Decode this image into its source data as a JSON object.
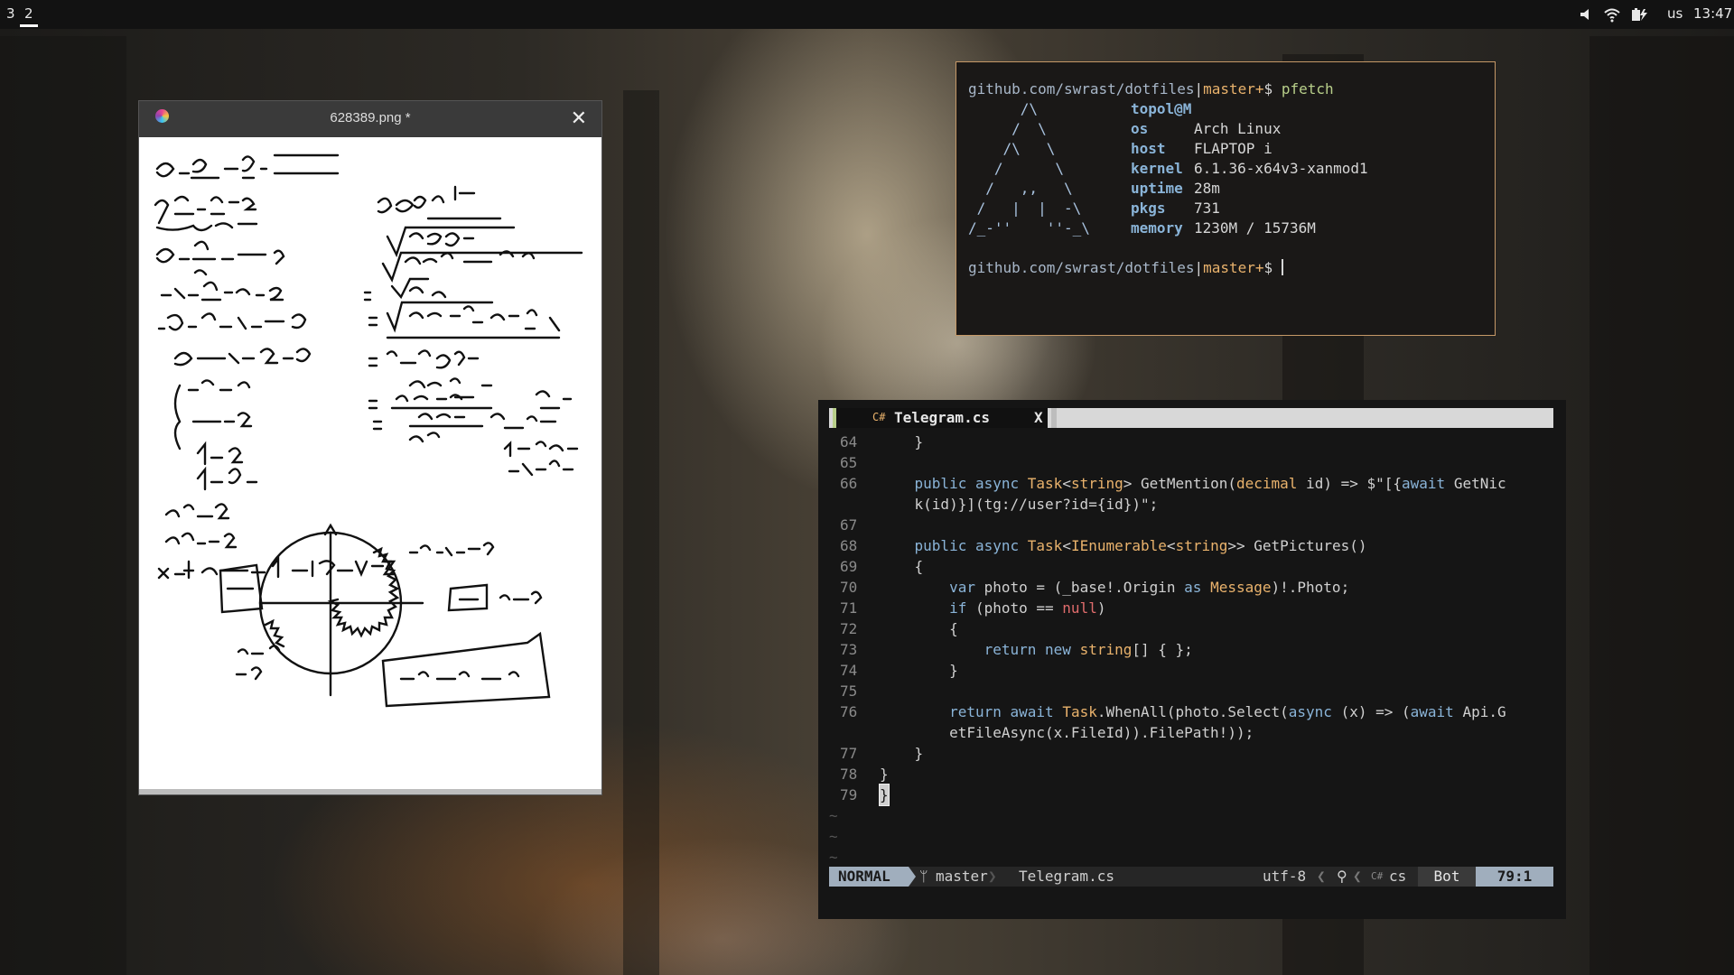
{
  "topbar": {
    "workspace_1": "3",
    "workspace_2": "2",
    "keyboard_layout": "us",
    "clock": "13:47"
  },
  "image_viewer": {
    "title": "628389.png *",
    "close_label": "✕"
  },
  "terminal": {
    "prompt_path": "github.com/swrast/dotfiles",
    "prompt_branch": "master+",
    "prompt_symbol": "$",
    "command": "pfetch",
    "user_host": "topol@M",
    "logo_lines": [
      "      /\\",
      "     /  \\",
      "    /\\   \\",
      "   /      \\",
      "  /   ,,   \\",
      " /   |  |  -\\",
      "/_-''    ''-_\\"
    ],
    "info": [
      {
        "key": "os",
        "value": "Arch Linux"
      },
      {
        "key": "host",
        "value": "FLAPTOP i"
      },
      {
        "key": "kernel",
        "value": "6.1.36-x64v3-xanmod1"
      },
      {
        "key": "uptime",
        "value": "28m"
      },
      {
        "key": "pkgs",
        "value": "731"
      },
      {
        "key": "memory",
        "value": "1230M / 15736M"
      }
    ]
  },
  "editor": {
    "tab_icon": "C#",
    "tab_name": "Telegram.cs",
    "tab_close": "X",
    "lines": [
      {
        "n": "64",
        "text": "    }"
      },
      {
        "n": "65",
        "text": ""
      },
      {
        "n": "66",
        "text": "    public async Task<string> GetMention(decimal id) => $\"[{await GetNic"
      },
      {
        "n": "",
        "text": "    k(id)}](tg://user?id={id})\";"
      },
      {
        "n": "67",
        "text": ""
      },
      {
        "n": "68",
        "text": "    public async Task<IEnumerable<string>> GetPictures()"
      },
      {
        "n": "69",
        "text": "    {"
      },
      {
        "n": "70",
        "text": "        var photo = (_base!.Origin as Message)!.Photo;"
      },
      {
        "n": "71",
        "text": "        if (photo == null)"
      },
      {
        "n": "72",
        "text": "        {"
      },
      {
        "n": "73",
        "text": "            return new string[] { };"
      },
      {
        "n": "74",
        "text": "        }"
      },
      {
        "n": "75",
        "text": ""
      },
      {
        "n": "76",
        "text": "        return await Task.WhenAll(photo.Select(async (x) => (await Api.G"
      },
      {
        "n": "",
        "text": "        etFileAsync(x.FileId)).FilePath!));"
      },
      {
        "n": "77",
        "text": "    }"
      },
      {
        "n": "78",
        "text": "}"
      },
      {
        "n": "79",
        "text": "}"
      }
    ],
    "tilde": "~",
    "status": {
      "mode": "NORMAL",
      "branch": "master",
      "file": "Telegram.cs",
      "encoding": "utf-8",
      "filetype": "cs",
      "scroll": "Bot",
      "position": "79:1"
    }
  }
}
